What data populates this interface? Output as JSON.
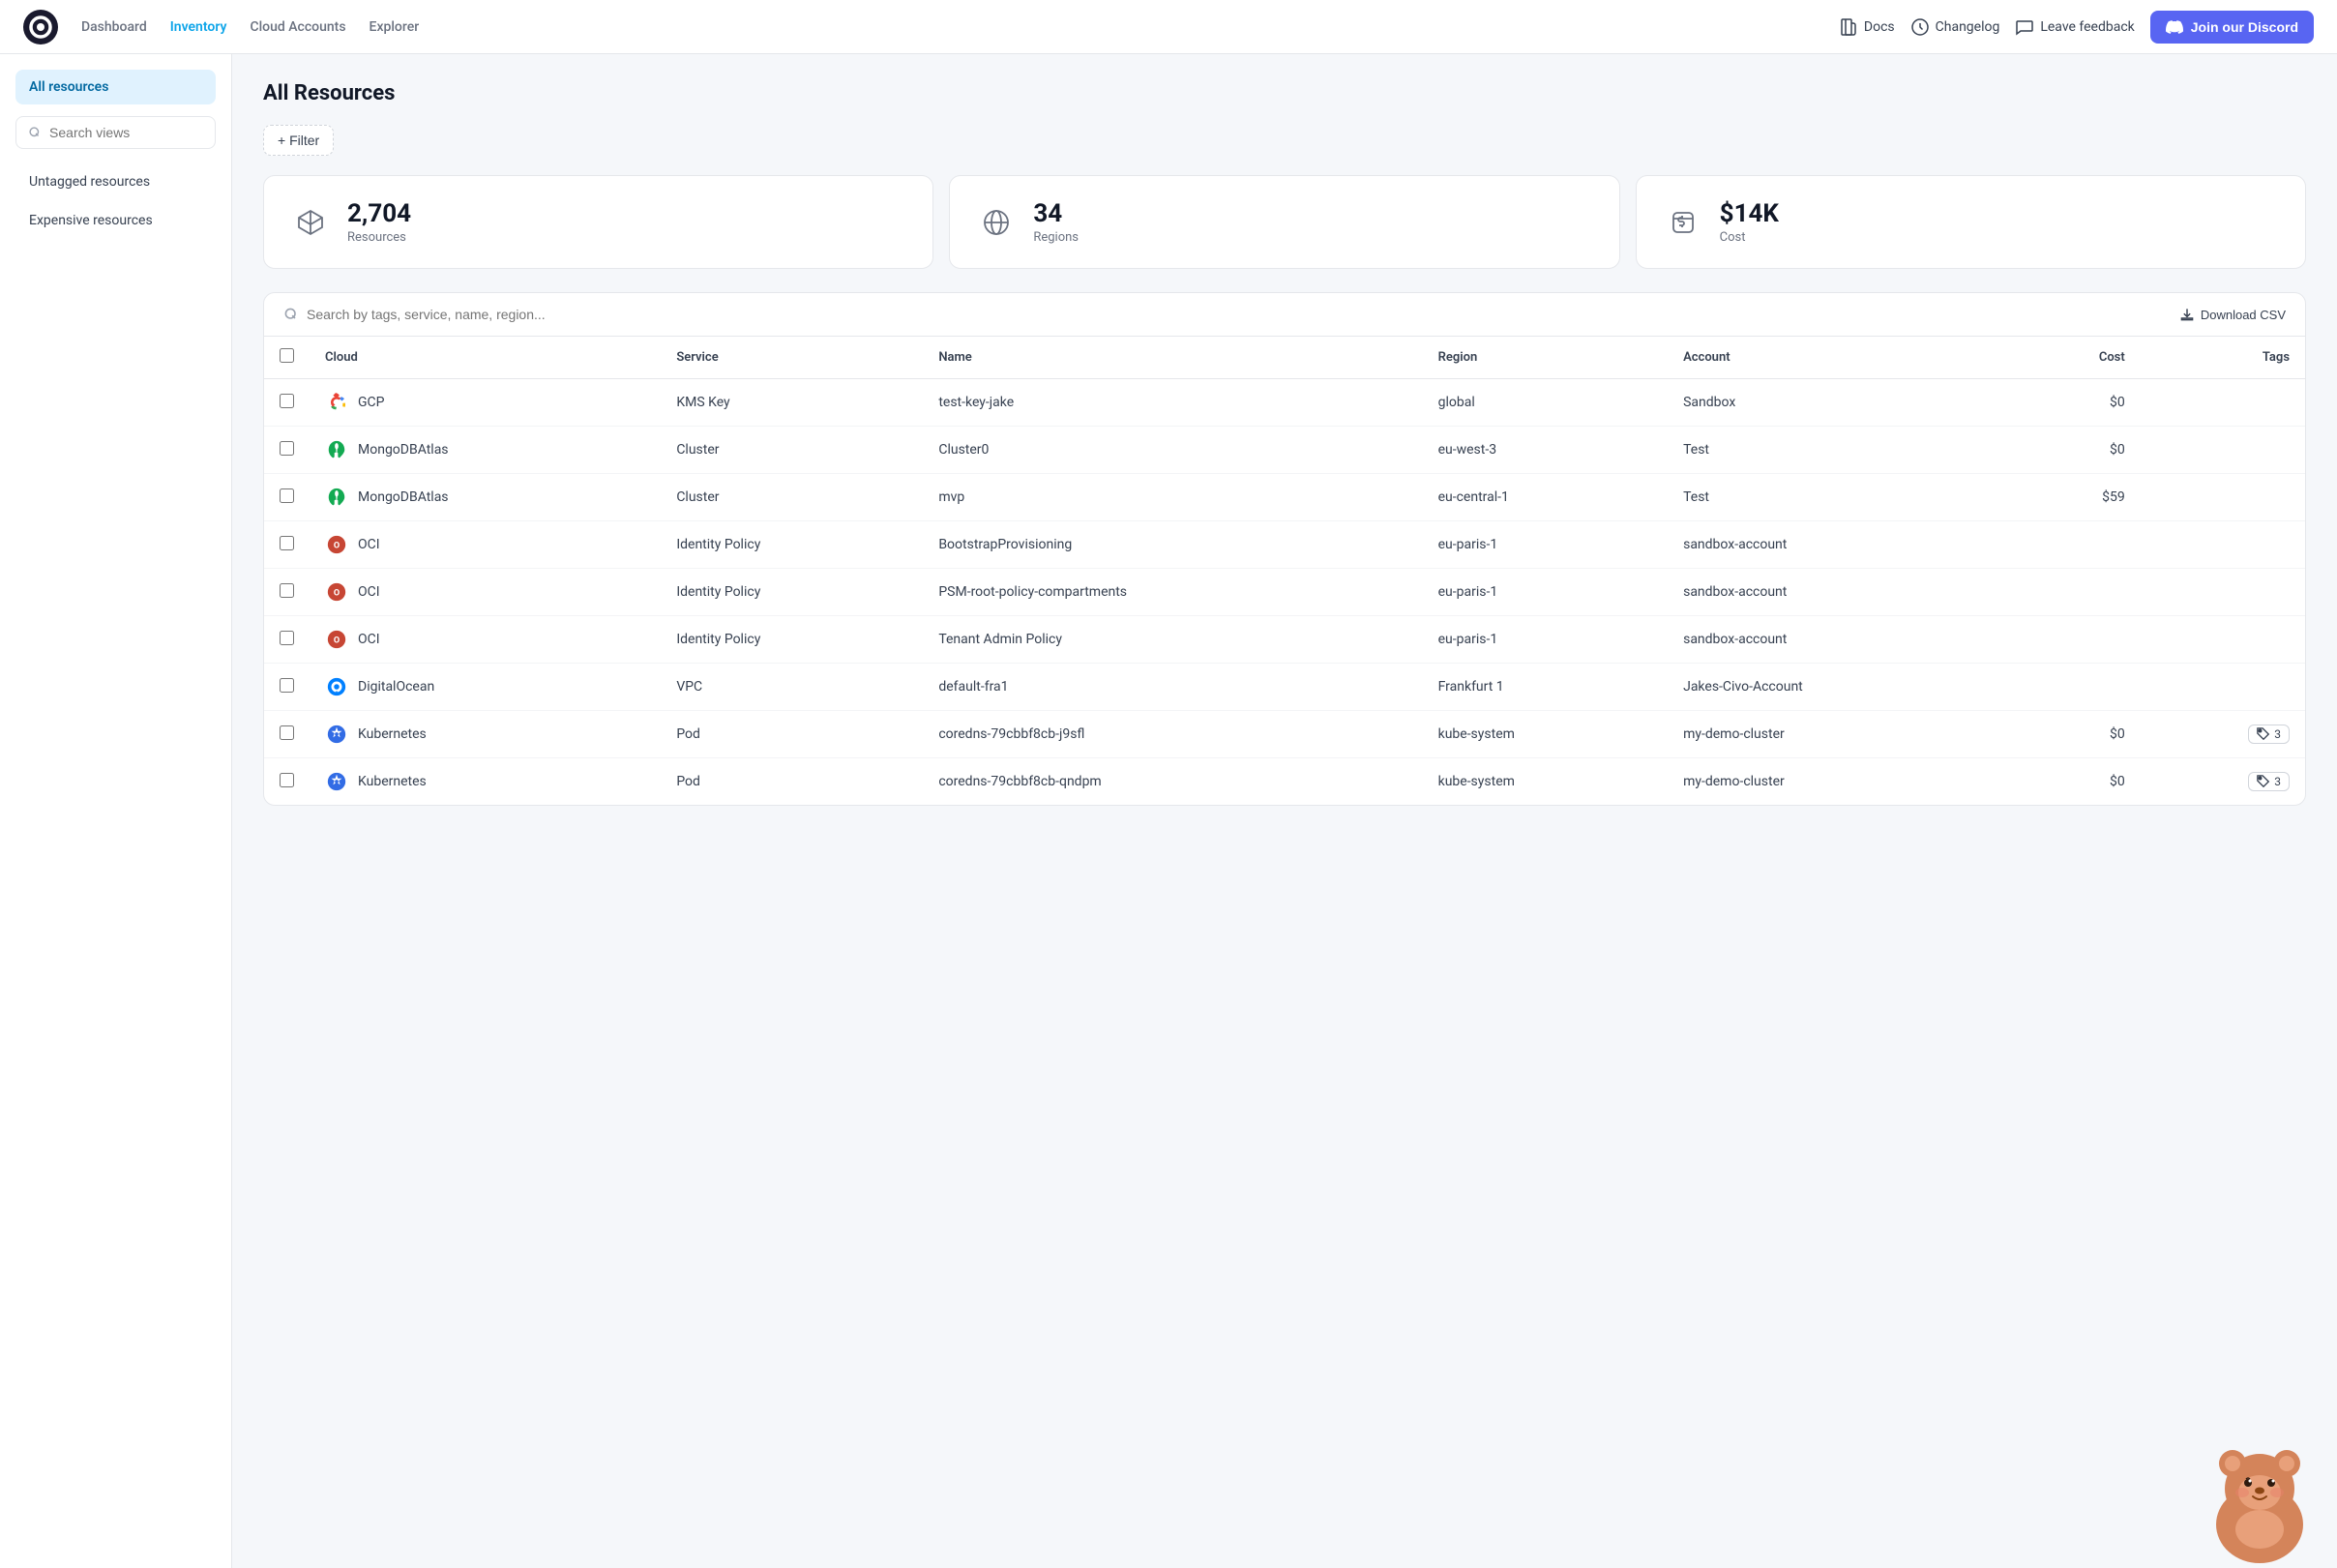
{
  "app": {
    "logo_alt": "Cloudchipr logo"
  },
  "topnav": {
    "links": [
      {
        "label": "Dashboard",
        "active": false,
        "name": "dashboard"
      },
      {
        "label": "Inventory",
        "active": true,
        "name": "inventory"
      },
      {
        "label": "Cloud Accounts",
        "active": false,
        "name": "cloud-accounts"
      },
      {
        "label": "Explorer",
        "active": false,
        "name": "explorer"
      }
    ],
    "docs_label": "Docs",
    "changelog_label": "Changelog",
    "feedback_label": "Leave feedback",
    "discord_label": "Join our Discord"
  },
  "sidebar": {
    "all_resources_label": "All resources",
    "search_placeholder": "Search views",
    "items": [
      {
        "label": "Untagged resources",
        "name": "untagged-resources"
      },
      {
        "label": "Expensive resources",
        "name": "expensive-resources"
      }
    ]
  },
  "page": {
    "title": "All Resources"
  },
  "filter": {
    "button_label": "+ Filter"
  },
  "stats": [
    {
      "value": "2,704",
      "label": "Resources",
      "icon": "cube"
    },
    {
      "value": "34",
      "label": "Regions",
      "icon": "globe"
    },
    {
      "value": "$14K",
      "label": "Cost",
      "icon": "wallet"
    }
  ],
  "table": {
    "search_placeholder": "Search by tags, service, name, region...",
    "download_label": "Download CSV",
    "columns": [
      "Cloud",
      "Service",
      "Name",
      "Region",
      "Account",
      "Cost",
      "Tags"
    ],
    "rows": [
      {
        "cloud": "GCP",
        "cloud_icon": "gcp",
        "service": "KMS Key",
        "name": "test-key-jake",
        "region": "global",
        "account": "Sandbox",
        "cost": "$0",
        "tags": []
      },
      {
        "cloud": "MongoDBAtlas",
        "cloud_icon": "mongodb",
        "service": "Cluster",
        "name": "Cluster0",
        "region": "eu-west-3",
        "account": "Test",
        "cost": "$0",
        "tags": []
      },
      {
        "cloud": "MongoDBAtlas",
        "cloud_icon": "mongodb",
        "service": "Cluster",
        "name": "mvp",
        "region": "eu-central-1",
        "account": "Test",
        "cost": "$59",
        "tags": []
      },
      {
        "cloud": "OCI",
        "cloud_icon": "oci",
        "service": "Identity Policy",
        "name": "BootstrapProvisioning",
        "region": "eu-paris-1",
        "account": "sandbox-account",
        "cost": "",
        "tags": []
      },
      {
        "cloud": "OCI",
        "cloud_icon": "oci",
        "service": "Identity Policy",
        "name": "PSM-root-policy-compartments",
        "region": "eu-paris-1",
        "account": "sandbox-account",
        "cost": "",
        "tags": []
      },
      {
        "cloud": "OCI",
        "cloud_icon": "oci",
        "service": "Identity Policy",
        "name": "Tenant Admin Policy",
        "region": "eu-paris-1",
        "account": "sandbox-account",
        "cost": "",
        "tags": []
      },
      {
        "cloud": "DigitalOcean",
        "cloud_icon": "digitalocean",
        "service": "VPC",
        "name": "default-fra1",
        "region": "Frankfurt 1",
        "account": "Jakes-Civo-Account",
        "cost": "",
        "tags": []
      },
      {
        "cloud": "Kubernetes",
        "cloud_icon": "kubernetes",
        "service": "Pod",
        "name": "coredns-79cbbf8cb-j9sfl",
        "region": "kube-system",
        "account": "my-demo-cluster",
        "cost": "$0",
        "tags": [
          "3"
        ]
      },
      {
        "cloud": "Kubernetes",
        "cloud_icon": "kubernetes",
        "service": "Pod",
        "name": "coredns-79cbbf8cb-qndpm",
        "region": "kube-system",
        "account": "my-demo-cluster",
        "cost": "$0",
        "tags": [
          "3"
        ]
      }
    ]
  },
  "colors": {
    "accent": "#0ea5e9",
    "discord_bg": "#5865f2",
    "sidebar_active_bg": "#e0f2fe",
    "sidebar_active_text": "#0369a1"
  }
}
